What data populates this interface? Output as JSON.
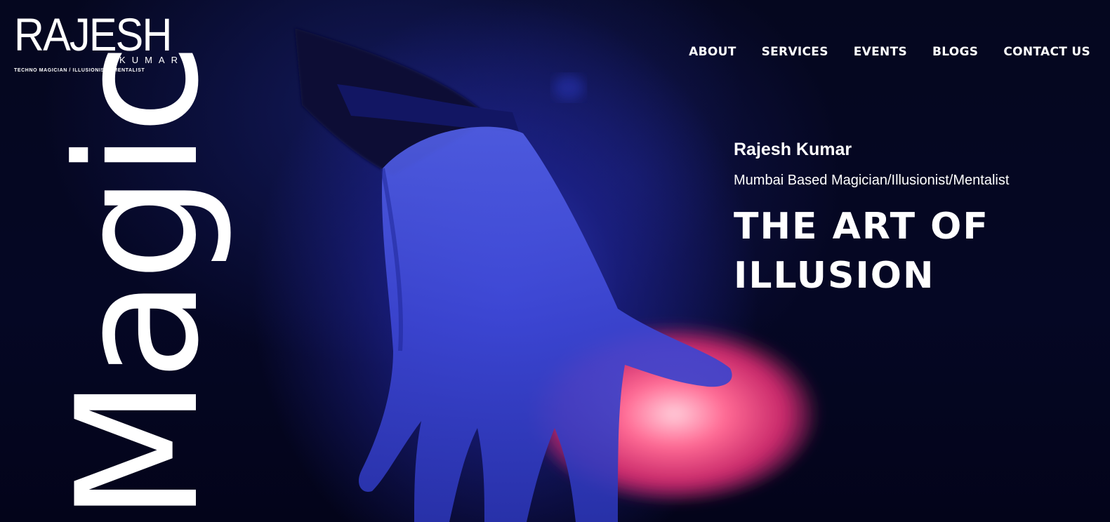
{
  "logo": {
    "main": "RAJESH",
    "sub": "KUMAR",
    "tagline": "TECHNO MAGICIAN / ILLUSIONIST / MENTALIST"
  },
  "nav": {
    "items": [
      {
        "label": "ABOUT"
      },
      {
        "label": "SERVICES"
      },
      {
        "label": "EVENTS"
      },
      {
        "label": "BLOGS"
      },
      {
        "label": "CONTACT US"
      }
    ]
  },
  "hero": {
    "vertical_word": "Magic",
    "name": "Rajesh Kumar",
    "role": "Mumbai Based Magician/Illusionist/Mentalist",
    "heading_line1": "THE ART OF",
    "heading_line2": "ILLUSION"
  },
  "colors": {
    "background": "#030516",
    "blue_light": "#3c46e6",
    "pink_glow": "#ff5a8c",
    "text": "#ffffff"
  }
}
